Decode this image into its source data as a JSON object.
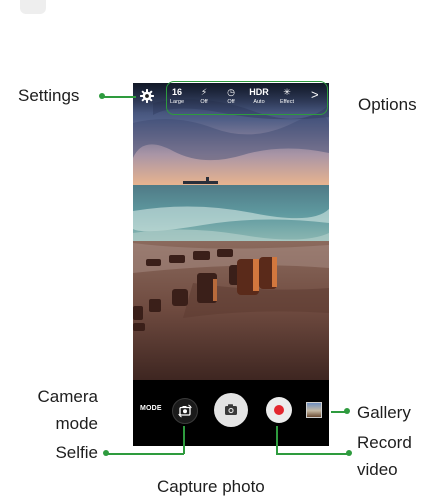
{
  "callouts": {
    "settings": "Settings",
    "options": "Options",
    "camera_mode_line1": "Camera",
    "camera_mode_line2": "mode",
    "selfie": "Selfie",
    "gallery": "Gallery",
    "record_line1": "Record",
    "record_line2": "video",
    "capture": "Capture photo"
  },
  "toolbar": {
    "options": [
      {
        "icon": "picture-size-icon",
        "glyph": "16",
        "label": "Large"
      },
      {
        "icon": "flash-off-icon",
        "glyph": "⚡",
        "label": "Off"
      },
      {
        "icon": "timer-icon",
        "glyph": "◷",
        "label": "Off"
      },
      {
        "icon": "hdr-icon",
        "glyph": "HDR",
        "label": "Auto"
      },
      {
        "icon": "effect-icon",
        "glyph": "✳",
        "label": "Effect"
      }
    ],
    "more_glyph": ">"
  },
  "bottom": {
    "mode_label": "MODE"
  },
  "colors": {
    "accent": "#2e9b3e",
    "record": "#e3262e"
  }
}
